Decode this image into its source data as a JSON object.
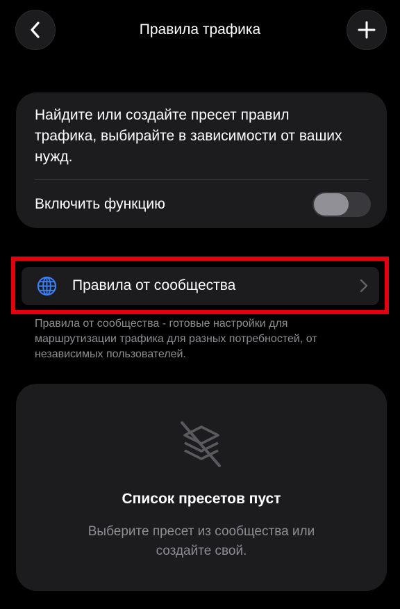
{
  "header": {
    "title": "Правила трафика",
    "back_icon": "chevron-left-icon",
    "add_icon": "plus-icon"
  },
  "info_card": {
    "text": "Найдите или создайте пресет правил трафика, выбирайте в зависимости от ваших нужд.",
    "toggle_label": "Включить функцию",
    "toggle_on": false
  },
  "community": {
    "label": "Правила от сообщества",
    "icon": "globe-icon",
    "description": "Правила от сообщества - готовые настройки для маршрутизации трафика для разных потребностей, от независимых пользователей."
  },
  "empty_state": {
    "icon": "layers-off-icon",
    "title": "Список пресетов пуст",
    "subtitle": "Выберите пресет из сообщества или создайте свой."
  },
  "colors": {
    "background": "#000000",
    "card": "#1c1c1e",
    "highlight": "#e3000f",
    "accent_blue": "#3d7ff4",
    "secondary_text": "#8e8e93"
  }
}
